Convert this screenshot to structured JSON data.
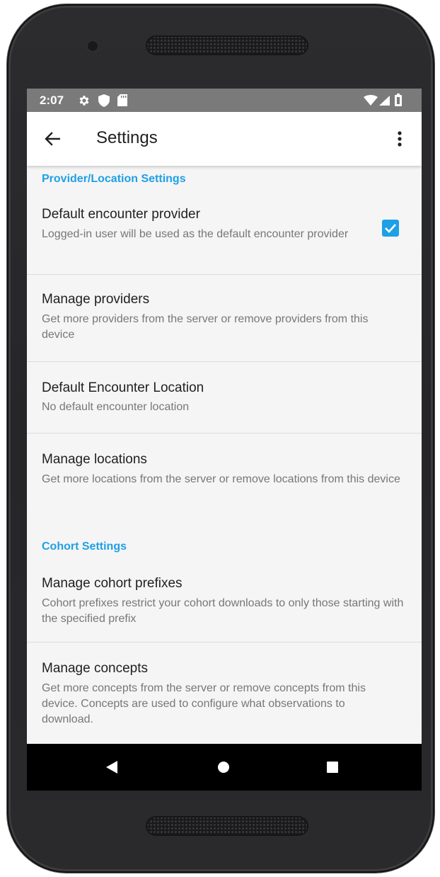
{
  "status_bar": {
    "time": "2:07",
    "icons": [
      "settings-icon",
      "shield-icon",
      "sd-card-icon",
      "wifi-icon",
      "signal-icon",
      "battery-icon"
    ]
  },
  "app_bar": {
    "title": "Settings",
    "back_icon": "arrow-back-icon",
    "menu_icon": "more-vert-icon"
  },
  "categories": {
    "provider_location": "Provider/Location Settings",
    "cohort": "Cohort Settings"
  },
  "preferences": {
    "default_provider": {
      "title": "Default encounter provider",
      "summary": "Logged-in user will be used as the default encounter provider",
      "checked": true
    },
    "manage_providers": {
      "title": "Manage providers",
      "summary": "Get more providers from the server or remove providers from this device"
    },
    "default_location": {
      "title": "Default Encounter Location",
      "summary": "No default encounter location"
    },
    "manage_locations": {
      "title": "Manage locations",
      "summary": "Get more locations from the server or remove locations from this device"
    },
    "cohort_prefixes": {
      "title": "Manage cohort prefixes",
      "summary": "Cohort prefixes restrict your cohort downloads to only those starting with the specified prefix"
    },
    "manage_concepts": {
      "title": "Manage concepts",
      "summary": "Get more concepts from the server or remove concepts from this device. Concepts are used to configure what observations to download."
    }
  },
  "nav_bar": {
    "icons": [
      "back-triangle-icon",
      "home-circle-icon",
      "recents-square-icon"
    ]
  },
  "colors": {
    "accent": "#1ea0e6",
    "status_bar": "#7a7a7a",
    "background": "#f5f5f5",
    "title_text": "#212121",
    "summary_text": "#777777"
  }
}
